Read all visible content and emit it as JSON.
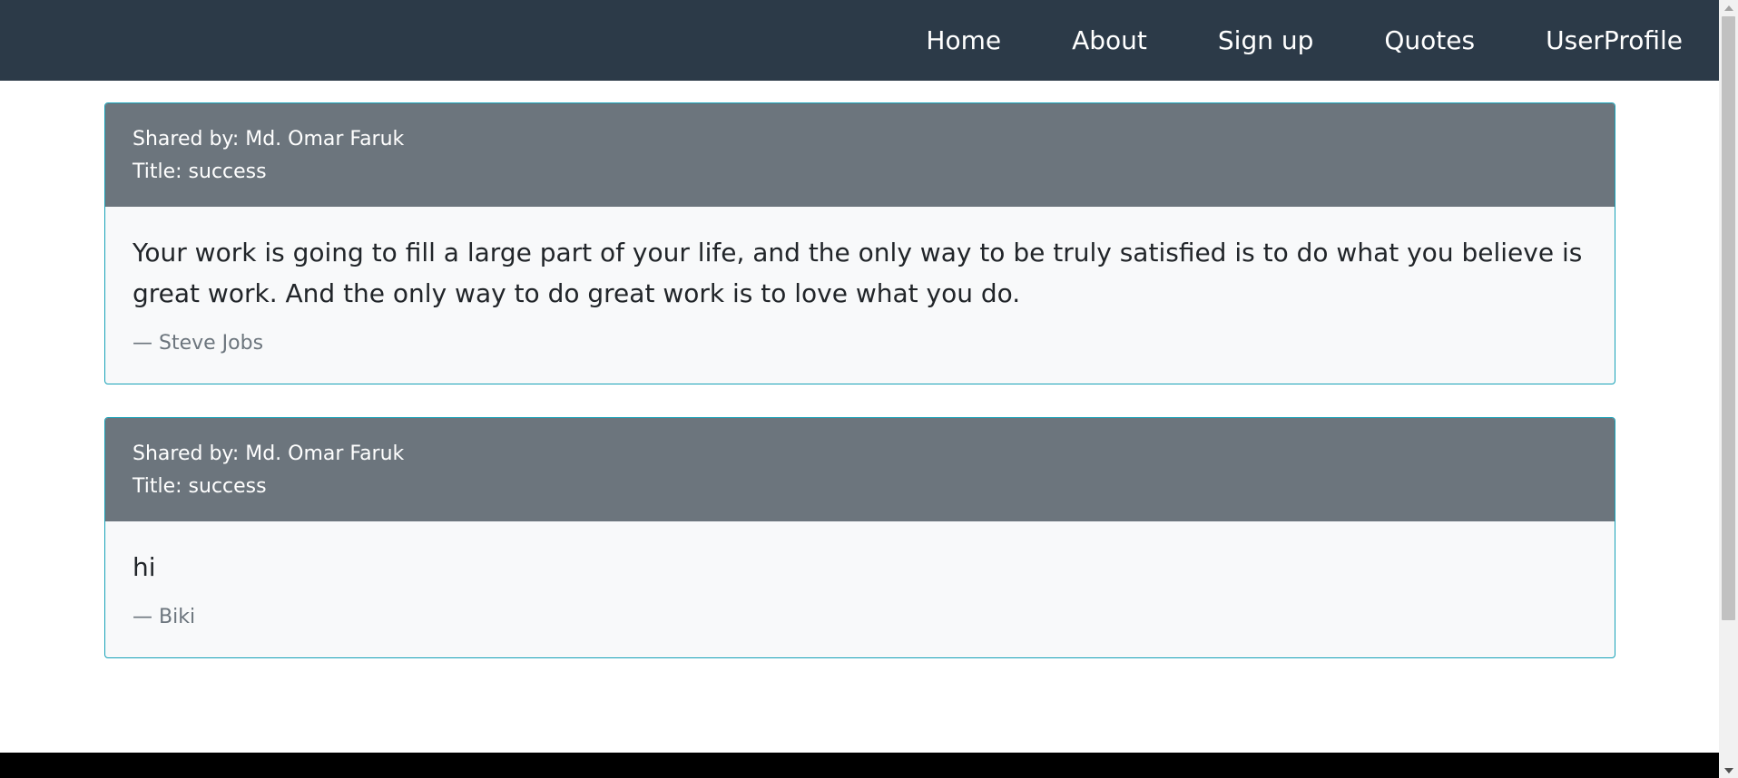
{
  "navbar": {
    "links": [
      {
        "label": "Home"
      },
      {
        "label": "About"
      },
      {
        "label": "Sign up"
      },
      {
        "label": "Quotes"
      },
      {
        "label": "UserProfile"
      }
    ]
  },
  "quotes": [
    {
      "shared_by": "Shared by: Md. Omar Faruk",
      "title": "Title: success",
      "text": "Your work is going to fill a large part of your life, and the only way to be truly satisfied is to do what you believe is great work. And the only way to do great work is to love what you do.",
      "author": "— Steve Jobs"
    },
    {
      "shared_by": "Shared by: Md. Omar Faruk",
      "title": "Title: success",
      "text": "hi",
      "author": "— Biki"
    }
  ],
  "colors": {
    "navbar_bg": "#2c3a48",
    "card_header_bg": "#6c757d",
    "card_border": "#17a2b8",
    "card_body_bg": "#f8f9fa",
    "footer_bg": "#000000"
  }
}
